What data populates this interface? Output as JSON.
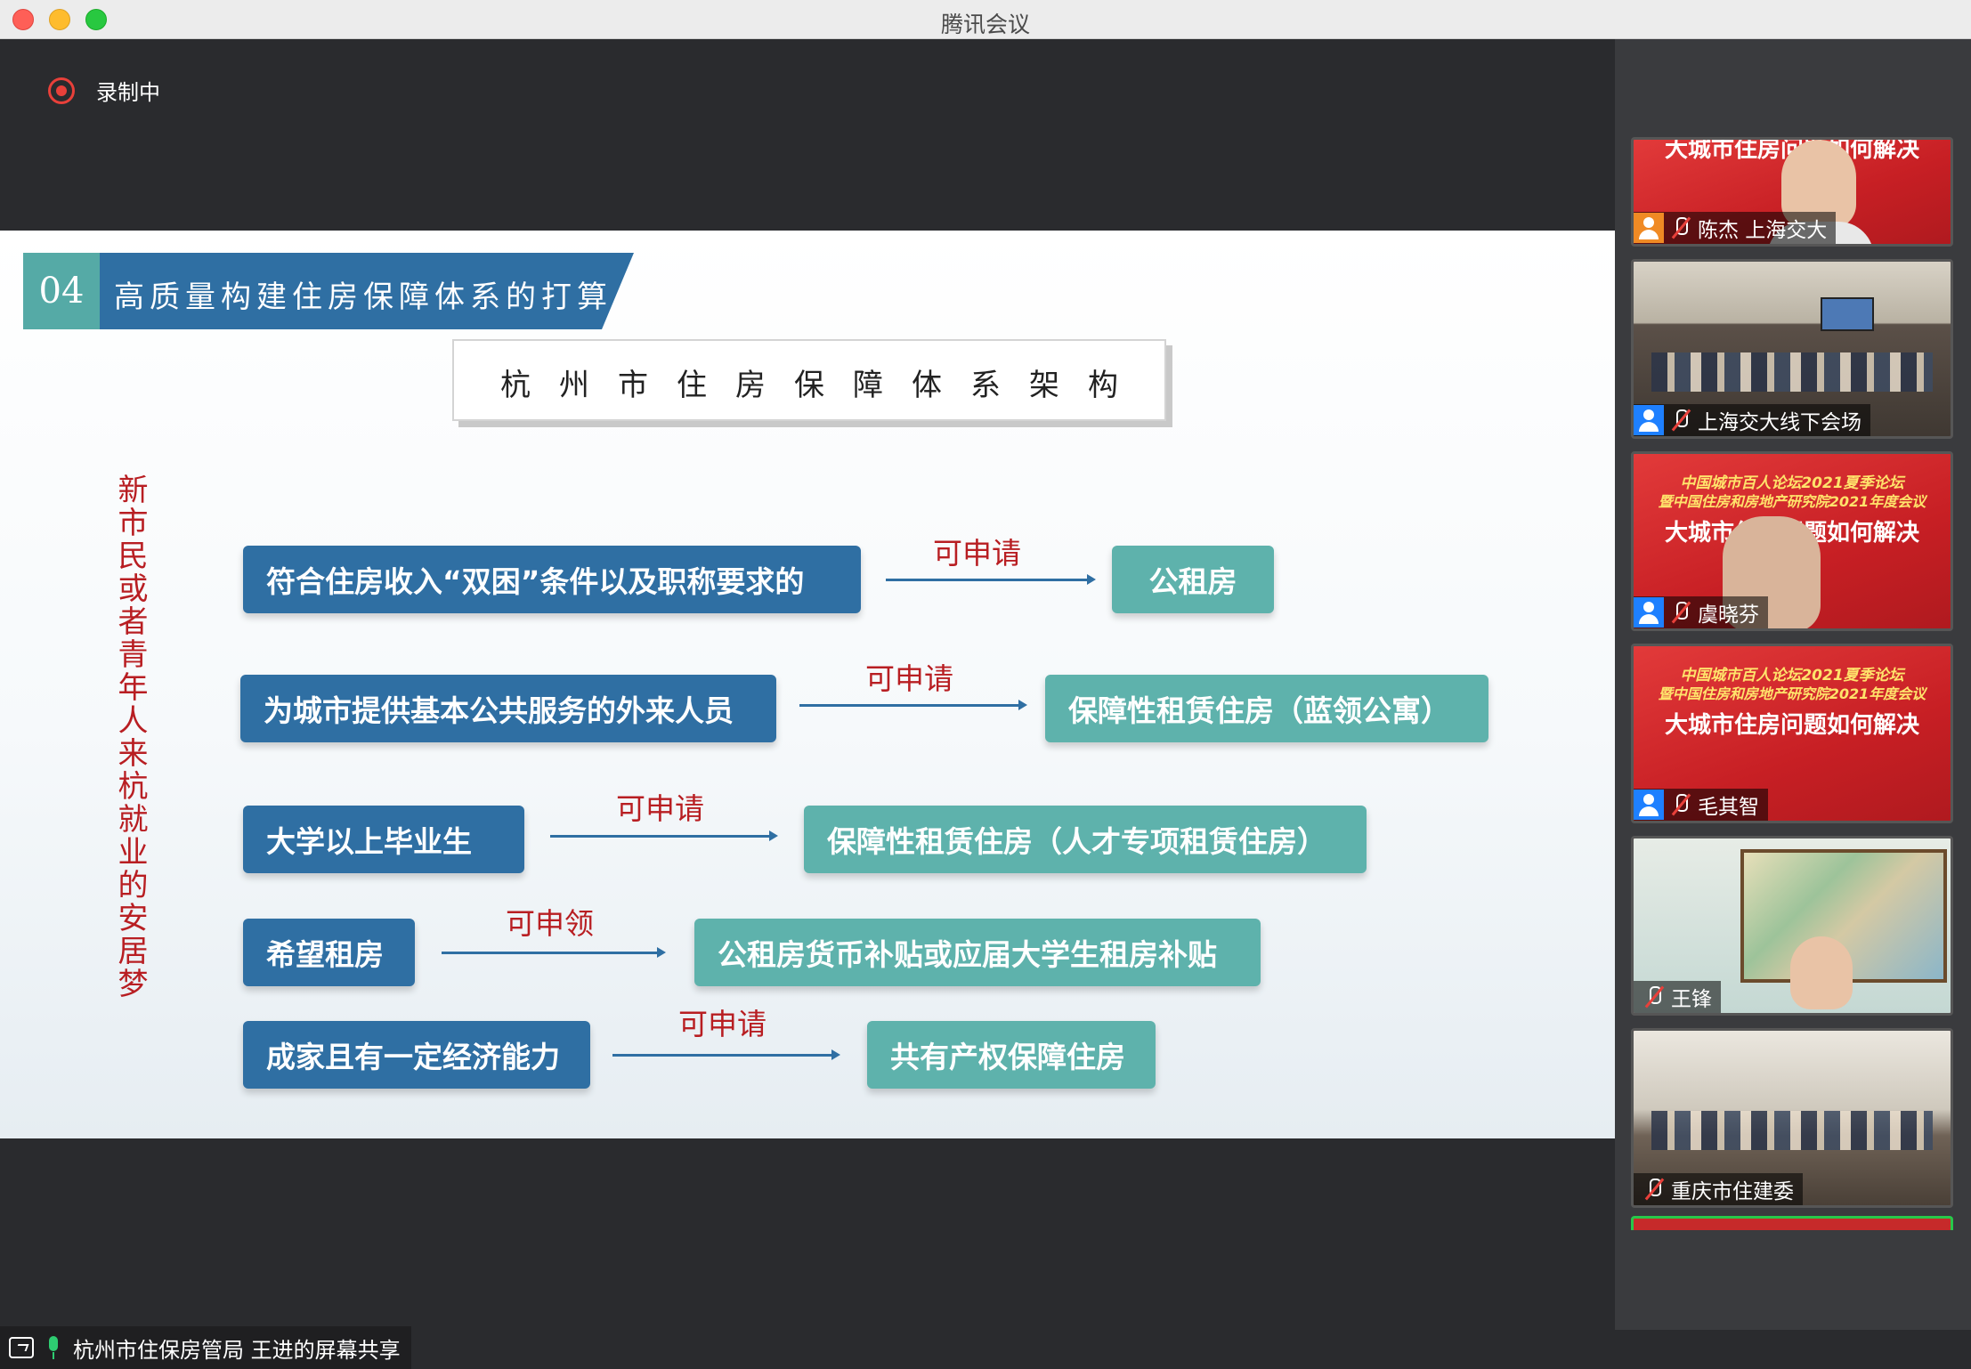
{
  "window": {
    "title": "腾讯会议"
  },
  "recording": {
    "label": "录制中"
  },
  "slide": {
    "section_number": "04",
    "section_title": "高质量构建住房保障体系的打算",
    "architecture_title": "杭州市住房保障体系架构",
    "vertical_text": "新市民或者青年人来杭就业的安居梦",
    "rows": [
      {
        "left": "符合住房收入“双困”条件以及职称要求的",
        "action": "可申请",
        "right": "公租房"
      },
      {
        "left": "为城市提供基本公共服务的外来人员",
        "action": "可申请",
        "right": "保障性租赁住房（蓝领公寓）"
      },
      {
        "left": "大学以上毕业生",
        "action": "可申请",
        "right": "保障性租赁住房（人才专项租赁住房）"
      },
      {
        "left": "希望租房",
        "action": "可申领",
        "right": "公租房货币补贴或应届大学生租房补贴"
      },
      {
        "left": "成家且有一定经济能力",
        "action": "可申请",
        "right": "共有产权保障住房"
      }
    ],
    "colors": {
      "blue": "#2f6fa3",
      "teal": "#5eb2ac",
      "red": "#b81e22"
    }
  },
  "share_bar": {
    "label": "杭州市住保房管局 王进的屏幕共享"
  },
  "participants": [
    {
      "name": "陈杰 上海交大",
      "poster_c": "大城市住房问题如何解决",
      "muted": true
    },
    {
      "name": "上海交大线下会场",
      "muted": true
    },
    {
      "name": "虞晓芬",
      "poster_a": "中国城市百人论坛2021夏季论坛",
      "poster_b": "暨中国住房和房地产研究院2021年度会议",
      "poster_c": "大城市住房问题如何解决",
      "muted": true
    },
    {
      "name": "毛其智",
      "poster_a": "中国城市百人论坛2021夏季论坛",
      "poster_b": "暨中国住房和房地产研究院2021年度会议",
      "poster_c": "大城市住房问题如何解决",
      "muted": true
    },
    {
      "name": "王锋",
      "muted": true
    },
    {
      "name": "重庆市住建委",
      "muted": true
    }
  ]
}
